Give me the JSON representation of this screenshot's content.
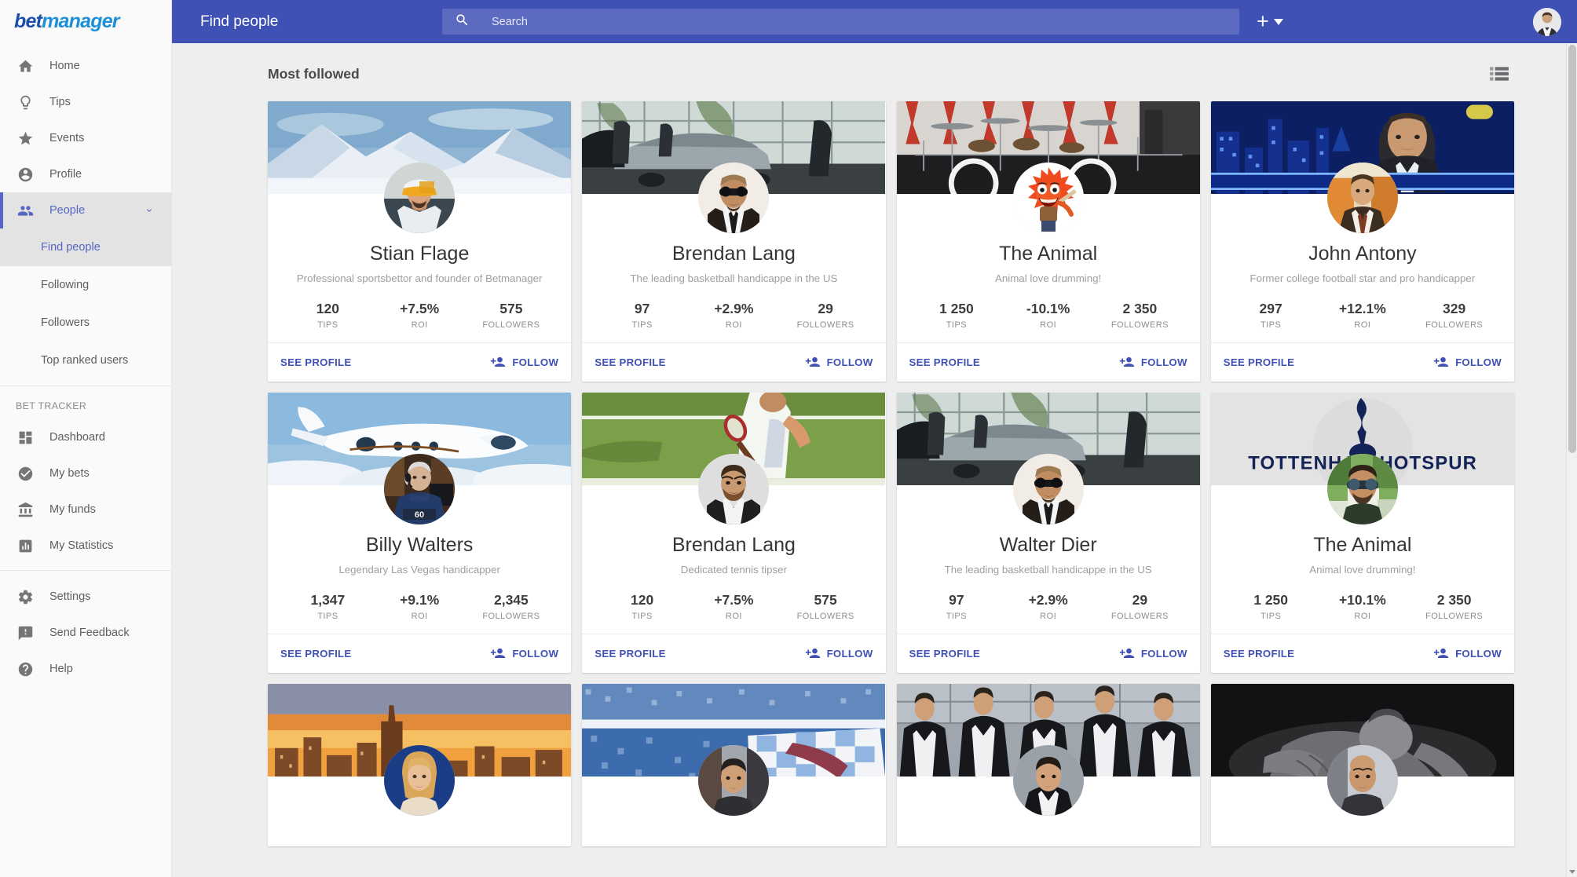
{
  "brand": {
    "part1": "bet",
    "part2": "manager"
  },
  "topbar": {
    "title": "Find people",
    "search_placeholder": "Search",
    "search_value": "",
    "search_icon": "search-icon",
    "add_icon": "plus-icon",
    "add_caret_icon": "caret-down-icon",
    "avatar_name": "user-avatar"
  },
  "sidebar": {
    "primary": [
      {
        "label": "Home",
        "icon": "home-icon"
      },
      {
        "label": "Tips",
        "icon": "lightbulb-icon"
      },
      {
        "label": "Events",
        "icon": "star-icon"
      },
      {
        "label": "Profile",
        "icon": "account-circle-icon"
      },
      {
        "label": "People",
        "icon": "people-icon",
        "active": true,
        "expandable": true
      }
    ],
    "people_sub": [
      {
        "label": "Find people",
        "active": true
      },
      {
        "label": "Following",
        "active": false
      },
      {
        "label": "Followers",
        "active": false
      },
      {
        "label": "Top ranked users",
        "active": false
      }
    ],
    "bet_tracker_label": "BET TRACKER",
    "bet_tracker": [
      {
        "label": "Dashboard",
        "icon": "dashboard-icon"
      },
      {
        "label": "My bets",
        "icon": "check-circle-icon"
      },
      {
        "label": "My funds",
        "icon": "bank-icon"
      },
      {
        "label": "My Statistics",
        "icon": "bar-chart-icon"
      }
    ],
    "footer": [
      {
        "label": "Settings",
        "icon": "gear-icon"
      },
      {
        "label": "Send Feedback",
        "icon": "feedback-icon"
      },
      {
        "label": "Help",
        "icon": "help-circle-icon"
      }
    ]
  },
  "main": {
    "section_title": "Most followed",
    "view_toggle_icon": "list-view-icon",
    "stat_labels": {
      "tips": "TIPS",
      "roi": "ROI",
      "followers": "FOLLOWERS"
    },
    "actions": {
      "see_profile": "SEE PROFILE",
      "follow": "FOLLOW",
      "follow_icon": "person-add-icon"
    },
    "colors": {
      "accent": "#3f51b5",
      "topbar": "#3f51b5",
      "search_field": "#5c6bc0",
      "page_bg": "#eeeeee",
      "sidebar_bg": "#fafafa",
      "active_item": "#5566c4"
    },
    "cards": [
      {
        "name": "Stian Flage",
        "tagline": "Professional sportsbettor and founder of Betmanager",
        "tips": "120",
        "roi": "+7.5%",
        "followers": "575",
        "cover": "snow-mountains",
        "avatar": "man-yellow-cap"
      },
      {
        "name": "Brendan Lang",
        "tagline": "The leading basketball handicappe in the US",
        "tips": "97",
        "roi": "+2.9%",
        "followers": "29",
        "cover": "car-showroom",
        "avatar": "man-sunglasses-suit"
      },
      {
        "name": "The Animal",
        "tagline": "Animal love drumming!",
        "tips": "1 250",
        "roi": "-10.1%",
        "followers": "2 350",
        "cover": "drum-kit-stage",
        "avatar": "muppet-animal"
      },
      {
        "name": "John Antony",
        "tagline": "Former college football star and pro handicapper",
        "tips": "297",
        "roi": "+12.1%",
        "followers": "329",
        "cover": "tv-studio-night",
        "avatar": "man-brown-suit"
      },
      {
        "name": "Billy Walters",
        "tagline": "Legendary Las Vegas handicapper",
        "tips": "1,347",
        "roi": "+9.1%",
        "followers": "2,345",
        "cover": "private-jet-sky",
        "avatar": "older-man-headset"
      },
      {
        "name": "Brendan Lang",
        "tagline": "Dedicated tennis tipser",
        "tips": "120",
        "roi": "+7.5%",
        "followers": "575",
        "cover": "tennis-grass-court",
        "avatar": "bearded-man-suit"
      },
      {
        "name": "Walter Dier",
        "tagline": "The leading basketball handicappe in the US",
        "tips": "97",
        "roi": "+2.9%",
        "followers": "29",
        "cover": "car-showroom",
        "avatar": "man-sunglasses-suit"
      },
      {
        "name": "The Animal",
        "tagline": "Animal love drumming!",
        "tips": "1 250",
        "roi": "+10.1%",
        "followers": "2 350",
        "cover": "tottenham-hotspur-crest",
        "avatar": "man-aviators"
      },
      {
        "name": "",
        "tagline": "",
        "tips": "",
        "roi": "",
        "followers": "",
        "cover": "nyc-skyline-sunset",
        "avatar": "blonde-woman",
        "partial": true
      },
      {
        "name": "",
        "tagline": "",
        "tips": "",
        "roi": "",
        "followers": "",
        "cover": "stadium-crowd-flag",
        "avatar": "dark-haired-man",
        "partial": true
      },
      {
        "name": "",
        "tagline": "",
        "tips": "",
        "roi": "",
        "followers": "",
        "cover": "men-in-tuxedos",
        "avatar": "young-man-suit",
        "partial": true
      },
      {
        "name": "",
        "tagline": "",
        "tips": "",
        "roi": "",
        "followers": "",
        "cover": "wrestler-bw",
        "avatar": "bald-man",
        "partial": true
      }
    ]
  }
}
